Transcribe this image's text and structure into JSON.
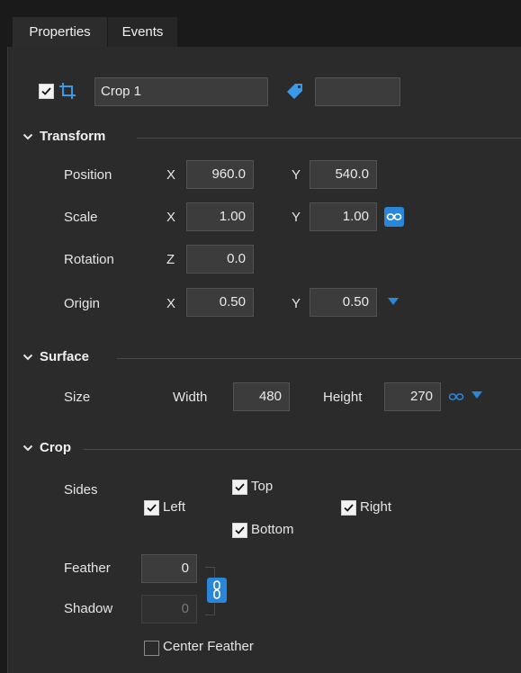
{
  "tabs": [
    {
      "label": "Properties",
      "active": true
    },
    {
      "label": "Events",
      "active": false
    }
  ],
  "header": {
    "enabled": true,
    "name": "Crop 1",
    "tag_value": ""
  },
  "transform": {
    "title": "Transform",
    "position": {
      "label": "Position",
      "x_axis": "X",
      "x": "960.0",
      "y_axis": "Y",
      "y": "540.0"
    },
    "scale": {
      "label": "Scale",
      "x_axis": "X",
      "x": "1.00",
      "y_axis": "Y",
      "y": "1.00"
    },
    "rotation": {
      "label": "Rotation",
      "z_axis": "Z",
      "z": "0.0"
    },
    "origin": {
      "label": "Origin",
      "x_axis": "X",
      "x": "0.50",
      "y_axis": "Y",
      "y": "0.50"
    }
  },
  "surface": {
    "title": "Surface",
    "size_label": "Size",
    "width_label": "Width",
    "width": "480",
    "height_label": "Height",
    "height": "270"
  },
  "crop": {
    "title": "Crop",
    "sides_label": "Sides",
    "left": {
      "label": "Left",
      "checked": true
    },
    "top": {
      "label": "Top",
      "checked": true
    },
    "bottom": {
      "label": "Bottom",
      "checked": true
    },
    "right": {
      "label": "Right",
      "checked": true
    },
    "feather_label": "Feather",
    "feather": "0",
    "shadow_label": "Shadow",
    "shadow": "0",
    "center_feather": {
      "label": "Center Feather",
      "checked": false
    }
  },
  "colors": {
    "accent": "#2a86d8",
    "panel_bg": "#2b2b2b",
    "field_bg": "#3c3c3c"
  }
}
